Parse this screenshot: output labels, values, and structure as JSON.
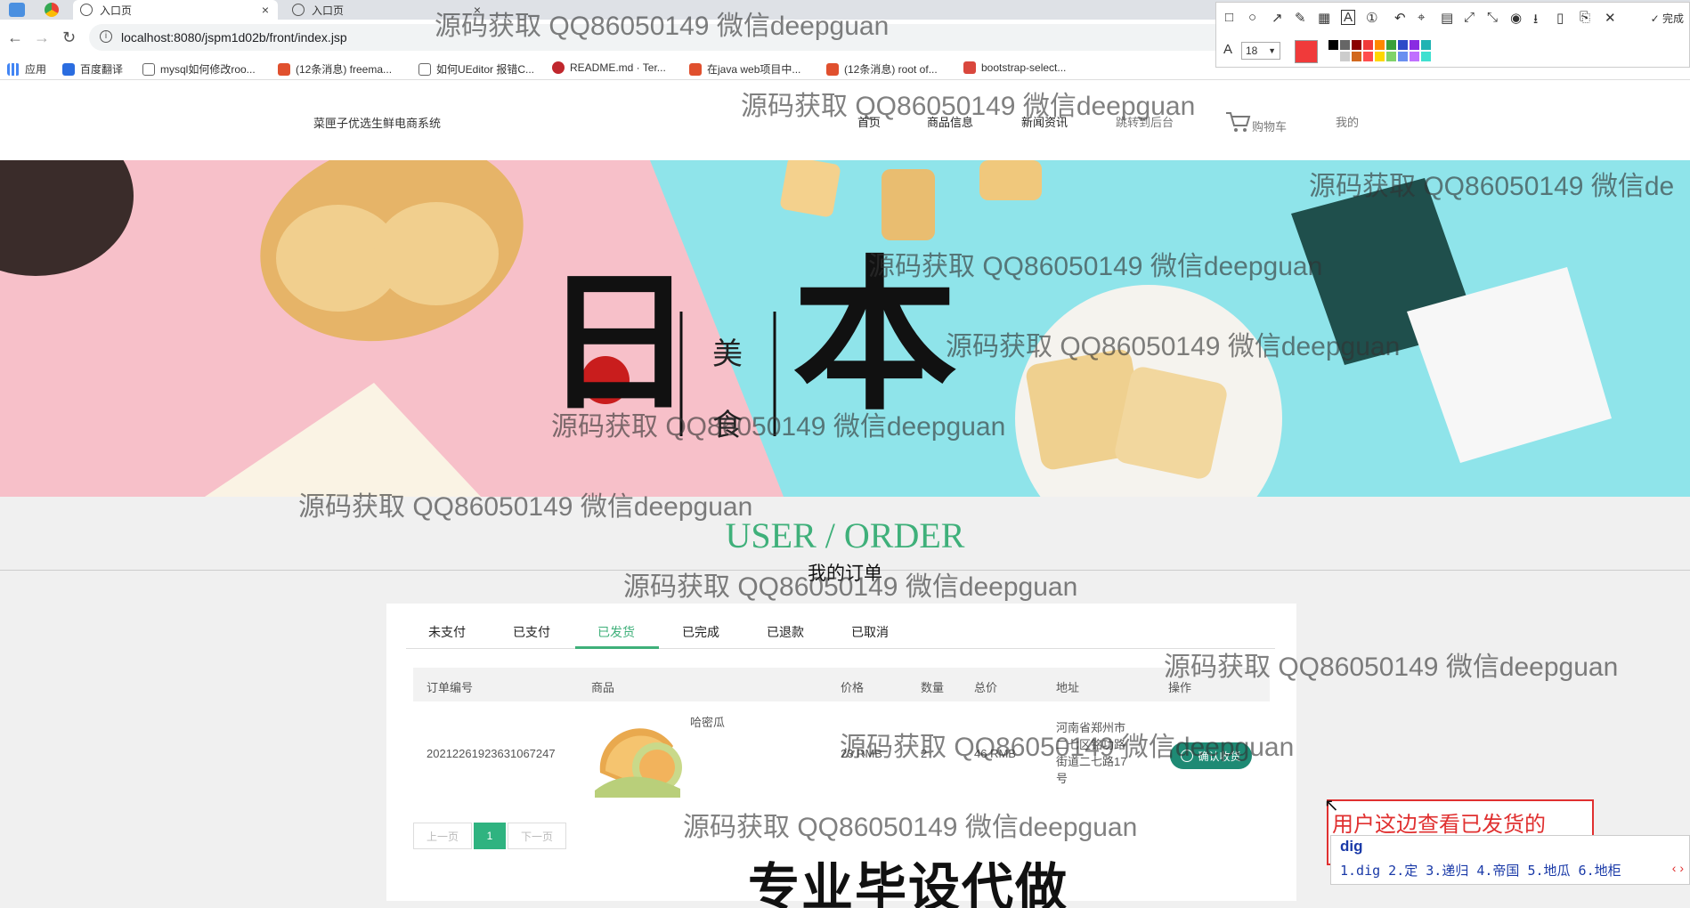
{
  "browser": {
    "tabs": [
      {
        "title": "入口页"
      },
      {
        "title": "入口页"
      }
    ],
    "url": "localhost:8080/jspm1d02b/front/index.jsp",
    "bookmarks": [
      "应用",
      "百度翻译",
      "mysql如何修改roo...",
      "(12条消息) freema...",
      "如何UEditor 报错C...",
      "README.md · Ter...",
      "在java web项目中...",
      "(12条消息) root of...",
      "bootstrap-select..."
    ]
  },
  "snap_toolbar": {
    "done_label": "完成",
    "font_size": "18",
    "font_label": "A",
    "current_color": "#f03a3a",
    "palette": [
      "#000000",
      "#666666",
      "#8b0000",
      "#f03a3a",
      "#ff8800",
      "#3aa03a",
      "#2e4bc8",
      "#8a2be2",
      "#1fb3b3",
      "#ffffff",
      "#cccccc",
      "#d2691e",
      "#ff4d4d",
      "#ffd700",
      "#7fd36a",
      "#6a8ff0",
      "#c070ff",
      "#40e0d0"
    ]
  },
  "site": {
    "logo": "菜匣子优选生鲜电商系统",
    "nav": [
      "首页",
      "商品信息",
      "新闻资讯",
      "跳转到后台",
      "购物车",
      "我的"
    ]
  },
  "banner": {
    "big_char_1": "日",
    "big_char_2": "本",
    "small_chars": [
      "美",
      "食"
    ]
  },
  "orders": {
    "title": "USER / ORDER",
    "subtitle": "我的订单",
    "tabs": [
      "未支付",
      "已支付",
      "已发货",
      "已完成",
      "已退款",
      "已取消"
    ],
    "active_tab": "已发货",
    "columns": [
      "订单编号",
      "商品",
      "价格",
      "数量",
      "总价",
      "地址",
      "操作"
    ],
    "rows": [
      {
        "order_no": "20212261923631067247",
        "product": "哈密瓜",
        "price": "23 RMB",
        "qty": "2",
        "total": "46 RMB",
        "address_lines": [
          "河南省郑州市",
          "二七区铭功路",
          "街道二七路17",
          "号"
        ],
        "action": "确认收货"
      }
    ],
    "pager": {
      "prev": "上一页",
      "current": "1",
      "next": "下一页"
    }
  },
  "annotation": {
    "text": "用户这边查看已发货的",
    "ime_typed": "dig",
    "ime_candidates": "1.dig  2.定  3.递归  4.帝国  5.地瓜  6.地柜"
  },
  "watermark": "源码获取 QQ86050149 微信deepguan",
  "watermark_cut": "源码获取 QQ86050149 微信de",
  "overlay_caption": "专业毕设代做"
}
